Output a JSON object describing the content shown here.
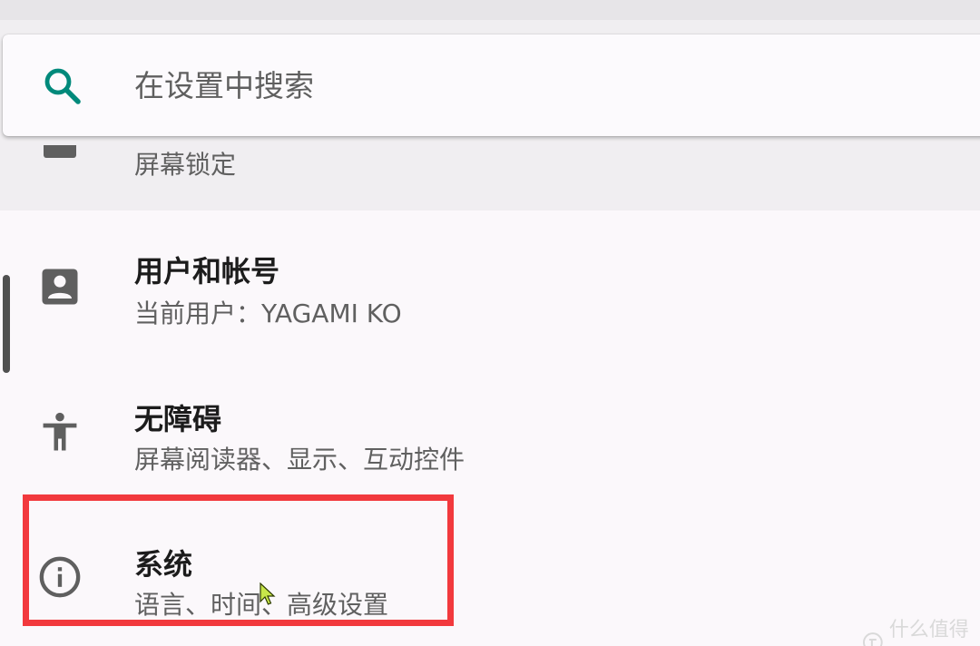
{
  "search": {
    "placeholder": "在设置中搜索"
  },
  "partial_item": {
    "subtitle": "屏幕锁定",
    "icon": "lock-screen-icon"
  },
  "items": [
    {
      "title": "用户和帐号",
      "subtitle": "当前用户：YAGAMI KO",
      "icon": "account-box-icon"
    },
    {
      "title": "无障碍",
      "subtitle": "屏幕阅读器、显示、互动控件",
      "icon": "accessibility-icon"
    },
    {
      "title": "系统",
      "subtitle": "语言、时间、高级设置",
      "icon": "info-icon"
    }
  ],
  "watermark": {
    "text": "什么值得买"
  },
  "colors": {
    "accent": "#00897b",
    "highlight": "#f2393d",
    "icon_gray": "#5f5f5f"
  }
}
